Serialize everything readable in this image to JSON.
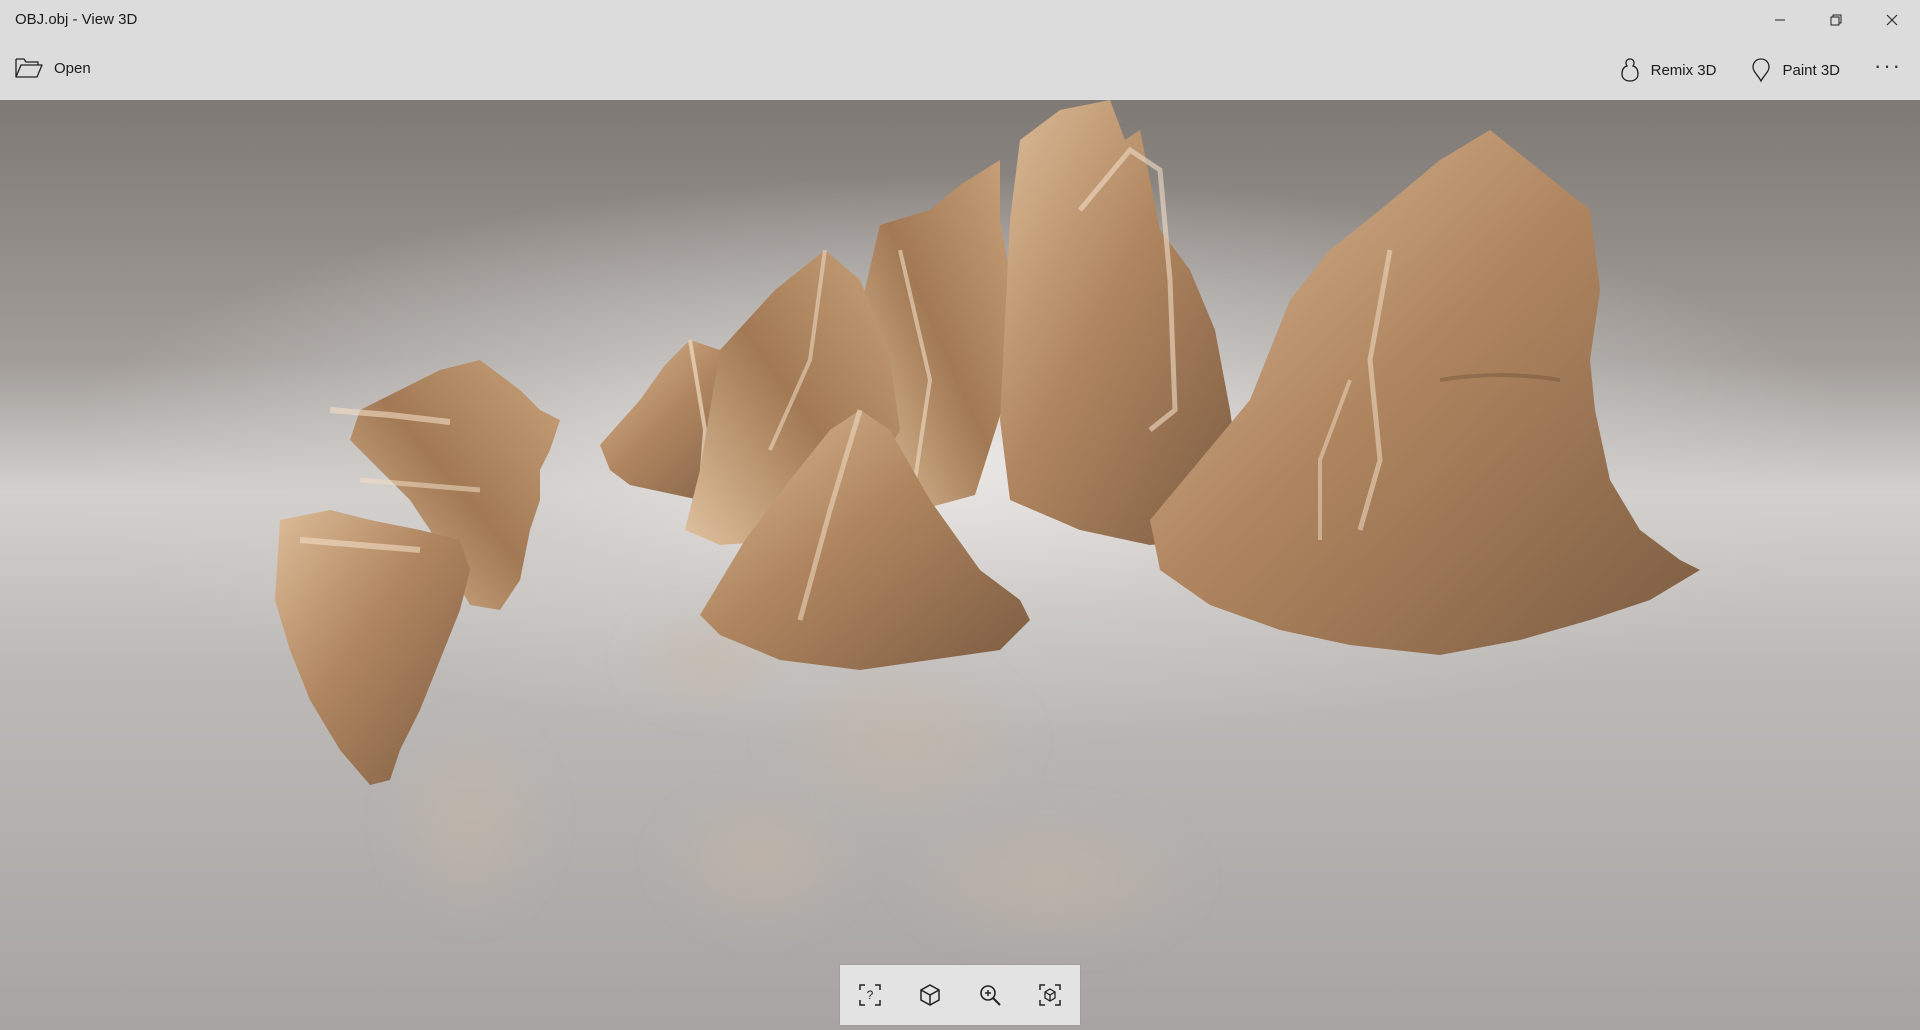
{
  "window": {
    "title": "OBJ.obj - View 3D"
  },
  "commandbar": {
    "open_label": "Open",
    "remix_label": "Remix 3D",
    "paint_label": "Paint 3D",
    "more_label": "···"
  },
  "icons": {
    "minimize": "minimize-icon",
    "maximize": "restore-icon",
    "close": "close-icon",
    "open": "folder-open-icon",
    "remix": "remix3d-icon",
    "paint": "paint3d-icon",
    "help": "help-icon",
    "view_mode": "cube-view-icon",
    "zoom": "zoom-in-icon",
    "reset_view": "reset-view-icon"
  },
  "colors": {
    "chrome": "#dcdcdc",
    "rock_light": "#d8b48c",
    "rock_dark": "#8a6a4c"
  }
}
